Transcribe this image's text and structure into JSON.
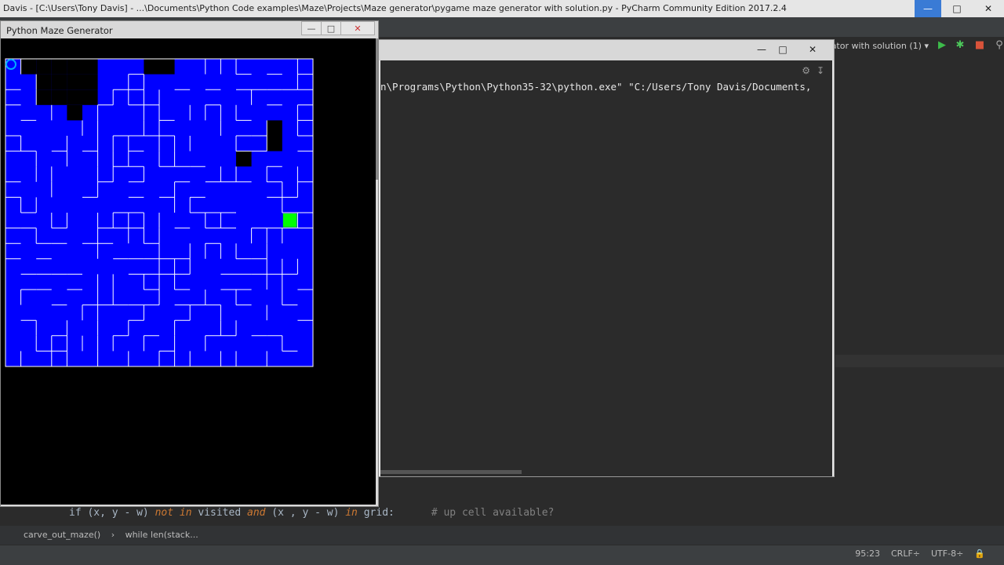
{
  "ide": {
    "title": "Davis - [C:\\Users\\Tony Davis] - ...\\Documents\\Python Code examples\\Maze\\Projects\\Maze generator\\pygame maze generator with solution.py - PyCharm Community Edition 2017.2.4",
    "run_config": "ator with solution (1)",
    "code_line": {
      "part1": "if (x, y - w) ",
      "kw1": "not in",
      "part2": " visited ",
      "kw2": "and",
      "part3": " (x , y - w) ",
      "kw3": "in",
      "part4": " grid:",
      "comment": "# up cell available?"
    },
    "breadcrumb": [
      "carve_out_maze()",
      "while len(stack..."
    ],
    "status": {
      "position": "95:23",
      "line_sep": "CRLF÷",
      "encoding": "UTF-8÷"
    }
  },
  "console": {
    "text": "n\\Programs\\Python\\Python35-32\\python.exe\" \"C:/Users/Tony Davis/Documents,"
  },
  "pygame": {
    "title": "Python Maze Generator",
    "colors": {
      "path": "#0000ff",
      "unvisited": "#000000",
      "wall": "#ffffff",
      "current": "#00ff00",
      "start": "#00aaff"
    },
    "maze": {
      "cols": 20,
      "rows": 20,
      "unvisited": [
        [
          1,
          0
        ],
        [
          2,
          0
        ],
        [
          3,
          0
        ],
        [
          4,
          0
        ],
        [
          5,
          0
        ],
        [
          2,
          1
        ],
        [
          3,
          1
        ],
        [
          4,
          1
        ],
        [
          5,
          1
        ],
        [
          2,
          2
        ],
        [
          3,
          2
        ],
        [
          4,
          2
        ],
        [
          5,
          2
        ],
        [
          4,
          3
        ],
        [
          9,
          0
        ],
        [
          10,
          0
        ],
        [
          17,
          4
        ],
        [
          17,
          5
        ],
        [
          15,
          6
        ]
      ],
      "current_cell": [
        18,
        10
      ],
      "start_cell": [
        0,
        0
      ]
    }
  }
}
